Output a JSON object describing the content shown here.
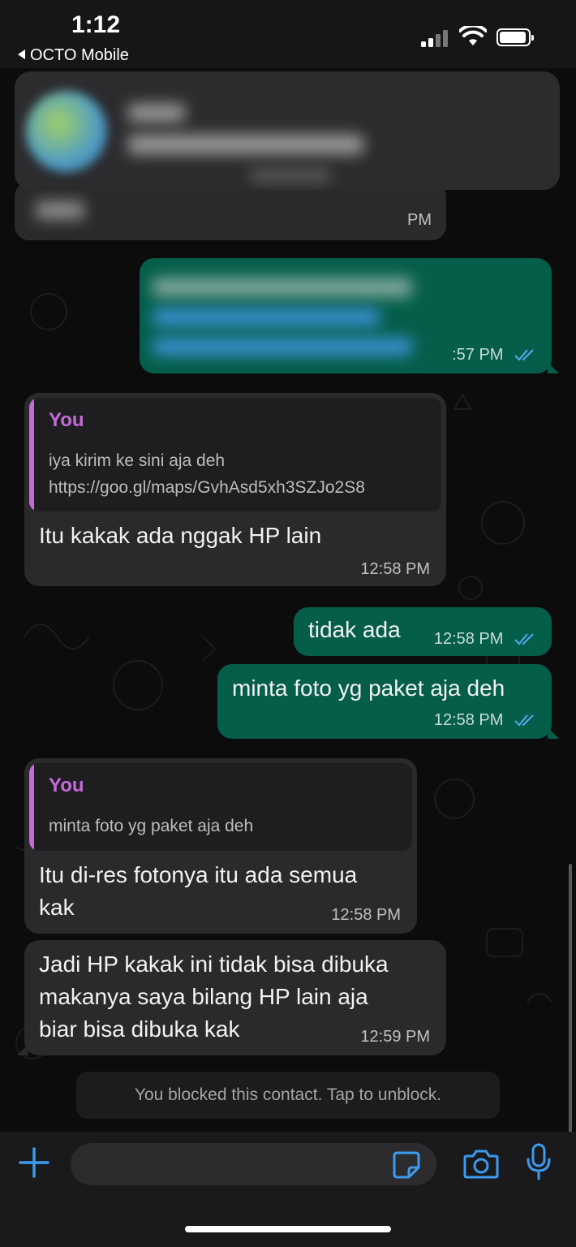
{
  "status_bar": {
    "time": "1:12",
    "back_app": "OCTO Mobile"
  },
  "colors": {
    "incoming_bubble": "#2a2a2c",
    "outgoing_bubble": "#055e4a",
    "quote_name": "#c56ad9",
    "accent_blue": "#3a9bf0",
    "read_ticks": "#53a8f0"
  },
  "header": {
    "back_icon": "chevron-left-icon"
  },
  "messages": [
    {
      "id": "m1",
      "direction": "incoming",
      "blurred": true,
      "time": "PM"
    },
    {
      "id": "m2",
      "direction": "outgoing",
      "blurred": true,
      "time": ":57 PM",
      "status": "read"
    },
    {
      "id": "m3",
      "direction": "incoming",
      "quote": {
        "author": "You",
        "line1": "iya kirim ke sini aja deh",
        "line2": "https://goo.gl/maps/GvhAsd5xh3SZJo2S8"
      },
      "text": "Itu kakak ada nggak HP lain",
      "time": "12:58 PM"
    },
    {
      "id": "m4",
      "direction": "outgoing",
      "text": "tidak ada",
      "time": "12:58 PM",
      "status": "read"
    },
    {
      "id": "m5",
      "direction": "outgoing",
      "text": "minta foto yg paket aja deh",
      "time": "12:58 PM",
      "status": "read"
    },
    {
      "id": "m6",
      "direction": "incoming",
      "quote": {
        "author": "You",
        "line1": "minta foto yg paket aja deh"
      },
      "text_line1": "Itu di-res fotonya itu ada semua",
      "text_line2": "kak",
      "time": "12:58 PM"
    },
    {
      "id": "m7",
      "direction": "incoming",
      "text_line1": "Jadi HP kakak ini tidak bisa dibuka",
      "text_line2": "makanya saya bilang HP lain aja",
      "text_line3": "biar bisa dibuka kak",
      "time": "12:59 PM"
    }
  ],
  "blocked_notice": "You blocked this contact. Tap to unblock.",
  "input_bar": {
    "icons": [
      "plus-icon",
      "sticker-icon",
      "camera-icon",
      "microphone-icon"
    ]
  }
}
